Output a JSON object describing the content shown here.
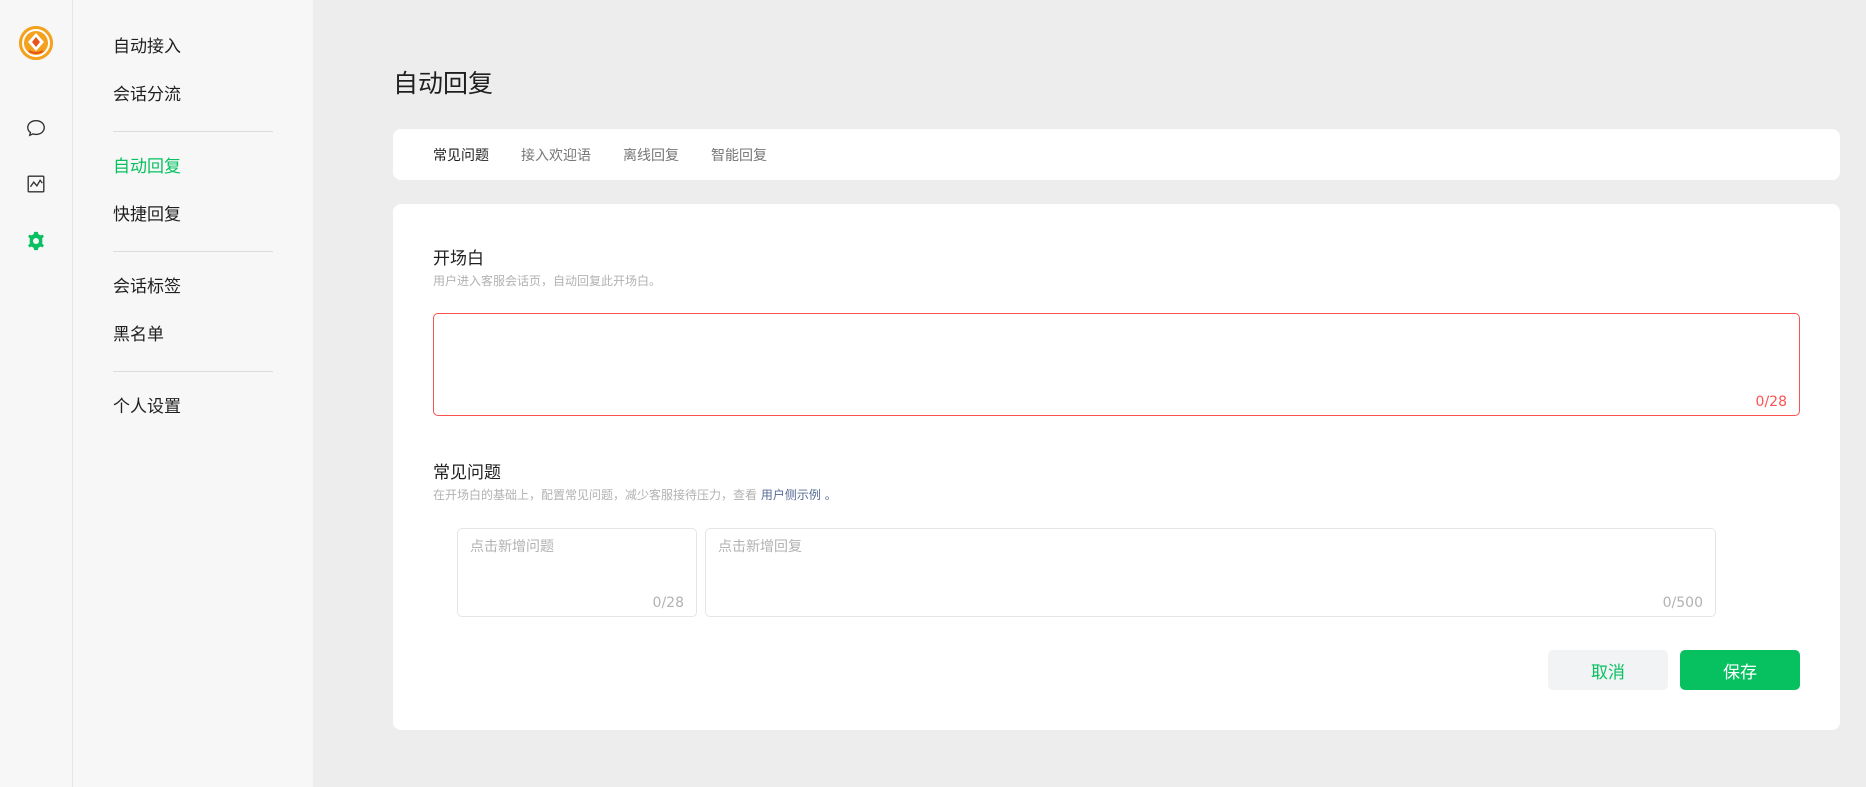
{
  "rail": {
    "icons": [
      "app-logo-icon",
      "chat-bubble-icon",
      "chart-icon",
      "gear-icon"
    ]
  },
  "sidebar": {
    "groups": [
      [
        {
          "label": "自动接入"
        },
        {
          "label": "会话分流"
        }
      ],
      [
        {
          "label": "自动回复",
          "active": true
        },
        {
          "label": "快捷回复"
        }
      ],
      [
        {
          "label": "会话标签"
        },
        {
          "label": "黑名单"
        }
      ],
      [
        {
          "label": "个人设置"
        }
      ]
    ]
  },
  "page": {
    "title": "自动回复",
    "tabs": [
      {
        "label": "常见问题",
        "active": true
      },
      {
        "label": "接入欢迎语"
      },
      {
        "label": "离线回复"
      },
      {
        "label": "智能回复"
      }
    ]
  },
  "opening": {
    "title": "开场白",
    "desc": "用户进入客服会话页，自动回复此开场白。",
    "value": "",
    "counter": "0/28"
  },
  "faq": {
    "title": "常见问题",
    "desc_prefix": "在开场白的基础上，配置常见问题，减少客服接待压力，查看",
    "desc_link": "用户侧示例",
    "desc_suffix": "。",
    "question_placeholder": "点击新增问题",
    "question_counter": "0/28",
    "answer_placeholder": "点击新增回复",
    "answer_counter": "0/500"
  },
  "actions": {
    "cancel_label": "取消",
    "save_label": "保存"
  },
  "colors": {
    "accent": "#07c160",
    "error": "#fa5151",
    "link": "#576b95"
  }
}
